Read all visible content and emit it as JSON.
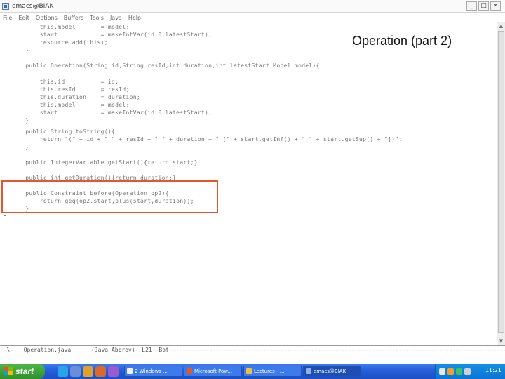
{
  "window": {
    "title": "emacs@BIAK",
    "minimize": "_",
    "maximize": "□",
    "close": "×"
  },
  "menu": [
    "File",
    "Edit",
    "Options",
    "Buffers",
    "Tools",
    "Java",
    "Help"
  ],
  "slide_title": "Operation (part 2)",
  "code": [
    "      this.model       = model;",
    "      start            = makeIntVar(id,0,latestStart);",
    "      resource.add(this);",
    "  }",
    "",
    "  public Operation(String id,String resId,int duration,int latestStart,Model model){",
    "      this.id          = id;",
    "      this.resId       = resId;",
    "      this.duration    = duration;",
    "      this.model       = model;",
    "      start            = makeIntVar(id,0,latestStart);",
    "  }",
    "",
    "  public String toString(){",
    "      return \"(\" + id + \" \" + resId + \" \" + duration + \" [\" + start.getInf() + \",\" + start.getSup() + \"])\";",
    "  }",
    "",
    "  public IntegerVariable getStart(){return start;}",
    "",
    "  public int getDuration(){return duration;}",
    "",
    "  public Constraint before(Operation op2){",
    "      return geq(op2.start,plus(start,duration));",
    "  }"
  ],
  "modeline": "--\\--  Operation.java      (Java Abbrev)--L21--Bot-----------------------------------------------------------------------------------------------------------------------------",
  "scrollbar": {
    "up": "▲",
    "down": "▼"
  },
  "taskbar": {
    "start_label": "start",
    "tasks": [
      "2 Windows ...",
      "Microsoft Pow...",
      "Lectures - ...",
      "emacs@BIAK"
    ],
    "active_task": "emacs@BIAK",
    "clock": "11:21"
  },
  "colors": {
    "highlight": "#e8552a",
    "taskbar": "#245edb",
    "start": "#2f8f2b"
  }
}
